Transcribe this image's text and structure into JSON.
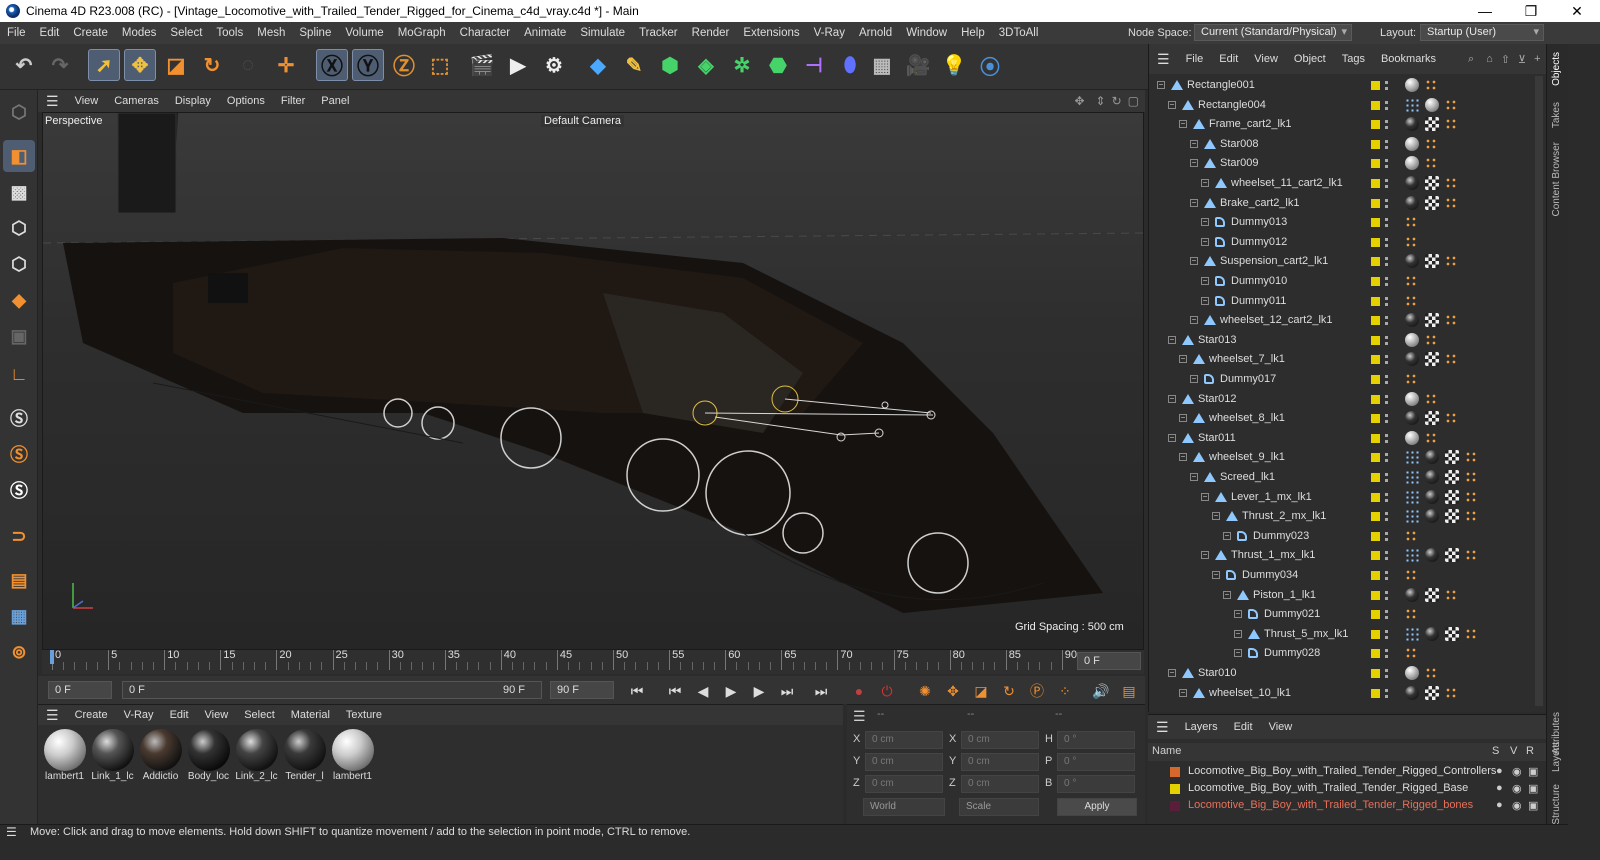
{
  "window": {
    "title": "Cinema 4D R23.008 (RC) - [Vintage_Locomotive_with_Trailed_Tender_Rigged_for_Cinema_c4d_vray.c4d *] - Main",
    "min": "—",
    "max": "❐",
    "close": "✕"
  },
  "menubar": {
    "items": [
      "File",
      "Edit",
      "Create",
      "Modes",
      "Select",
      "Tools",
      "Mesh",
      "Spline",
      "Volume",
      "MoGraph",
      "Character",
      "Animate",
      "Simulate",
      "Tracker",
      "Render",
      "Extensions",
      "V-Ray",
      "Arnold",
      "Window",
      "Help",
      "3DToAll"
    ],
    "node_space_label": "Node Space:",
    "node_space_value": "Current (Standard/Physical)",
    "layout_label": "Layout:",
    "layout_value": "Startup (User)"
  },
  "viewport": {
    "menu": [
      "View",
      "Cameras",
      "Display",
      "Options",
      "Filter",
      "Panel"
    ],
    "label": "Perspective",
    "camera": "Default Camera",
    "grid_spacing": "Grid Spacing : 500 cm"
  },
  "timeline": {
    "ticks": [
      "0",
      "5",
      "10",
      "15",
      "20",
      "25",
      "30",
      "35",
      "40",
      "45",
      "50",
      "55",
      "60",
      "65",
      "70",
      "75",
      "80",
      "85",
      "90"
    ],
    "current_frame": "0 F"
  },
  "transport": {
    "start": "0 F",
    "range_start": "0 F",
    "range_end": "90 F",
    "end": "90 F"
  },
  "materials": {
    "menu": [
      "Create",
      "V-Ray",
      "Edit",
      "View",
      "Select",
      "Material",
      "Texture"
    ],
    "items": [
      "lambert1",
      "Link_1_lc",
      "Addictio",
      "Body_loc",
      "Link_2_lc",
      "Tender_l",
      "lambert1"
    ]
  },
  "coords": {
    "header": [
      "--",
      "--",
      "--"
    ],
    "rows": [
      [
        "X",
        "0 cm",
        "X",
        "0 cm",
        "H",
        "0 °"
      ],
      [
        "Y",
        "0 cm",
        "Y",
        "0 cm",
        "P",
        "0 °"
      ],
      [
        "Z",
        "0 cm",
        "Z",
        "0 cm",
        "B",
        "0 °"
      ]
    ],
    "mode": "World",
    "scale": "Scale",
    "apply": "Apply"
  },
  "objects": {
    "menu": [
      "File",
      "Edit",
      "View",
      "Object",
      "Tags",
      "Bookmarks"
    ],
    "rows": [
      {
        "name": "Rectangle001",
        "level": 0
      },
      {
        "name": "Rectangle004",
        "level": 1
      },
      {
        "name": "Frame_cart2_lk1",
        "level": 2
      },
      {
        "name": "Star008",
        "level": 3
      },
      {
        "name": "Star009",
        "level": 3
      },
      {
        "name": "wheelset_11_cart2_lk1",
        "level": 4
      },
      {
        "name": "Brake_cart2_lk1",
        "level": 3
      },
      {
        "name": "Dummy013",
        "level": 4
      },
      {
        "name": "Dummy012",
        "level": 4
      },
      {
        "name": "Suspension_cart2_lk1",
        "level": 3
      },
      {
        "name": "Dummy010",
        "level": 4
      },
      {
        "name": "Dummy011",
        "level": 4
      },
      {
        "name": "wheelset_12_cart2_lk1",
        "level": 3
      },
      {
        "name": "Star013",
        "level": 1
      },
      {
        "name": "wheelset_7_lk1",
        "level": 2
      },
      {
        "name": "Dummy017",
        "level": 3
      },
      {
        "name": "Star012",
        "level": 1
      },
      {
        "name": "wheelset_8_lk1",
        "level": 2
      },
      {
        "name": "Star011",
        "level": 1
      },
      {
        "name": "wheelset_9_lk1",
        "level": 2
      },
      {
        "name": "Screed_lk1",
        "level": 3
      },
      {
        "name": "Lever_1_mx_lk1",
        "level": 4
      },
      {
        "name": "Thrust_2_mx_lk1",
        "level": 5
      },
      {
        "name": "Dummy023",
        "level": 6
      },
      {
        "name": "Thrust_1_mx_lk1",
        "level": 4
      },
      {
        "name": "Dummy034",
        "level": 5
      },
      {
        "name": "Piston_1_lk1",
        "level": 6
      },
      {
        "name": "Dummy021",
        "level": 7
      },
      {
        "name": "Thrust_5_mx_lk1",
        "level": 7
      },
      {
        "name": "Dummy028",
        "level": 7
      },
      {
        "name": "Star010",
        "level": 1
      },
      {
        "name": "wheelset_10_lk1",
        "level": 2
      }
    ]
  },
  "side_tabs": [
    "Objects",
    "Takes",
    "Content Browser",
    "Attributes",
    "Layers",
    "Structure"
  ],
  "layers": {
    "menu": [
      "Layers",
      "Edit",
      "View"
    ],
    "col_name": "Name",
    "cols": [
      "S",
      "V",
      "R"
    ],
    "rows": [
      {
        "name": "Locomotive_Big_Boy_with_Trailed_Tender_Rigged_Controllers",
        "color": "#d7682b"
      },
      {
        "name": "Locomotive_Big_Boy_with_Trailed_Tender_Rigged_Base",
        "color": "#e5d000"
      },
      {
        "name": "Locomotive_Big_Boy_with_Trailed_Tender_Rigged_bones",
        "color": "#5a1d3a"
      }
    ]
  },
  "status": "Move: Click and drag to move elements. Hold down SHIFT to quantize movement / add to the selection in point mode, CTRL to remove.",
  "colors": {
    "accent": "#4f5d73",
    "layer_text_bones": "#e8705a"
  }
}
